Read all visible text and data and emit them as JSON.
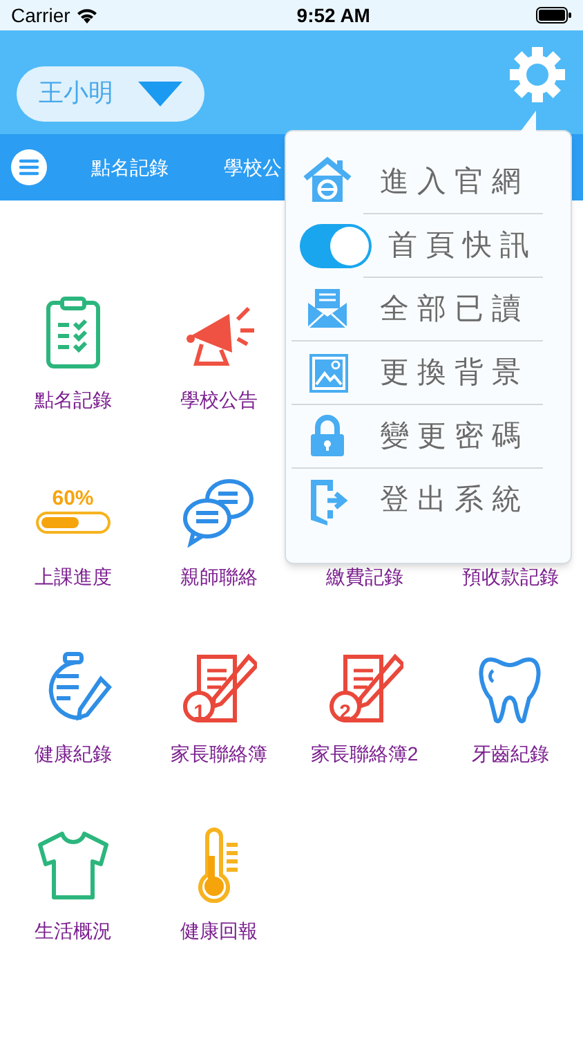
{
  "status_bar": {
    "carrier": "Carrier",
    "time": "9:52 AM"
  },
  "header": {
    "student": "王小明"
  },
  "tabs": [
    {
      "label": "點名記錄",
      "selected": false
    },
    {
      "label": "學校公",
      "selected": false
    }
  ],
  "grid": [
    [
      {
        "kind": "clipboard",
        "label": "點名記錄"
      },
      {
        "kind": "megaphone",
        "label": "學校公告"
      }
    ],
    [
      {
        "kind": "progress",
        "badge": "60%",
        "level": 0.6,
        "label": "上課進度"
      },
      {
        "kind": "chat",
        "label": "親師聯絡"
      },
      {
        "label": "繳費記錄"
      },
      {
        "label": "預收款記錄"
      }
    ],
    [
      {
        "kind": "health",
        "label": "健康紀錄"
      },
      {
        "kind": "notebook",
        "badge": "1",
        "label": "家長聯絡簿"
      },
      {
        "kind": "notebook",
        "badge": "2",
        "label": "家長聯絡簿2"
      },
      {
        "kind": "tooth",
        "label": "牙齒紀錄"
      }
    ],
    [
      {
        "kind": "shirt",
        "label": "生活概況"
      },
      {
        "kind": "thermometer",
        "label": "健康回報"
      }
    ]
  ],
  "menu": [
    {
      "kind": "home",
      "label": "進入官網"
    },
    {
      "kind": "toggle",
      "on": true,
      "label": "首頁快訊"
    },
    {
      "kind": "mail",
      "label": "全部已讀"
    },
    {
      "kind": "image",
      "label": "更換背景"
    },
    {
      "kind": "lock",
      "label": "變更密碼"
    },
    {
      "kind": "exit",
      "label": "登出系統"
    }
  ]
}
